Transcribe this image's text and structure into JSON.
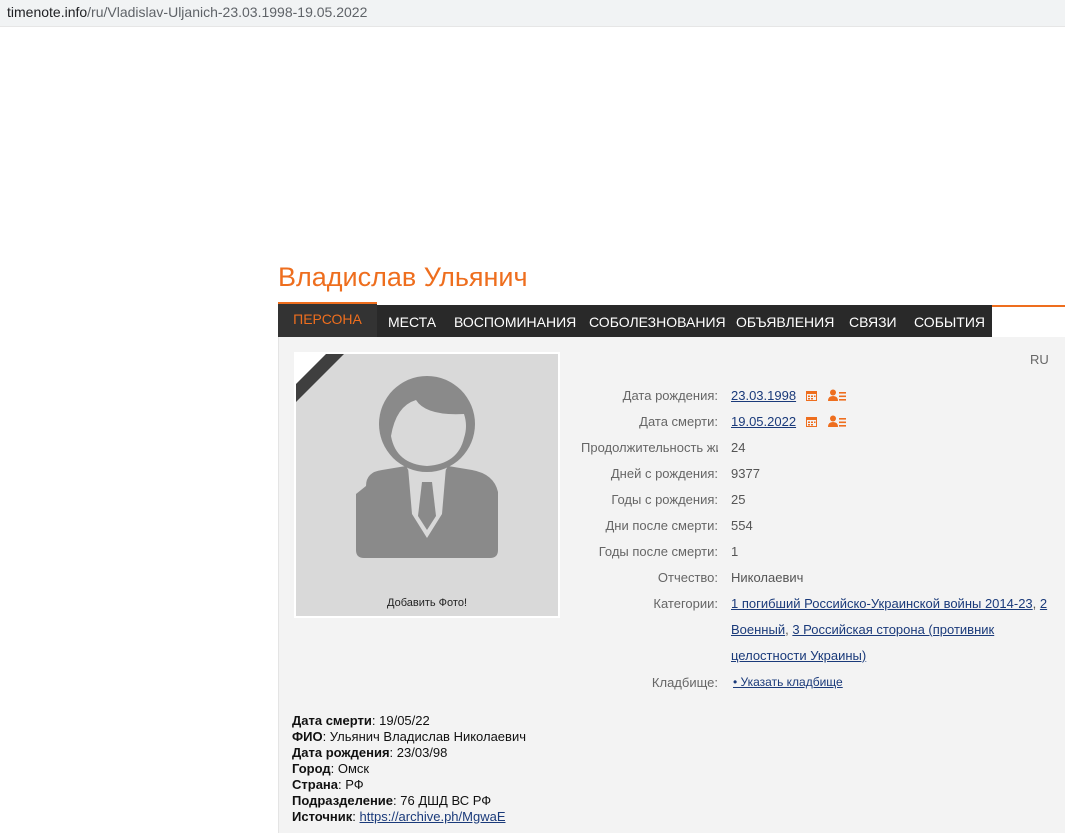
{
  "browser": {
    "url_domain": "timenote.info",
    "url_path": "/ru/Vladislav-Uljanich-23.03.1998-19.05.2022"
  },
  "page": {
    "title": "Владислав Ульянич",
    "lang": "RU"
  },
  "nav": {
    "tabs": [
      "ПЕРСОНА",
      "МЕСТА",
      "ВОСПОМИНАНИЯ",
      "СОБОЛЕЗНОВАНИЯ",
      "ОБЪЯВЛЕНИЯ",
      "СВЯЗИ",
      "СОБЫТИЯ"
    ],
    "active": "ПЕРСОНА"
  },
  "photo": {
    "add_label": "Добавить Фото!"
  },
  "facts": {
    "birth_label": "Дата рождения:",
    "birth_value": "23.03.1998",
    "death_label": "Дата смерти:",
    "death_value": "19.05.2022",
    "lifespan_label": "Продолжительность жизни:",
    "lifespan_value": "24",
    "days_since_birth_label": "Дней с рождения:",
    "days_since_birth_value": "9377",
    "years_since_birth_label": "Годы с рождения:",
    "years_since_birth_value": "25",
    "days_since_death_label": "Дни после смерти:",
    "days_since_death_value": "554",
    "years_since_death_label": "Годы после смерти:",
    "years_since_death_value": "1",
    "patronymic_label": "Отчество:",
    "patronymic_value": "Николаевич",
    "categories_label": "Категории:",
    "categories": [
      "1 погибший Российско-Украинской войны 2014-23",
      "2 Военный",
      "3 Российская сторона (противник целостности Украины)"
    ],
    "cemetery_label": "Кладбище:",
    "cemetery_link": "• Указать кладбище"
  },
  "info": {
    "death_date_key": "Дата смерти",
    "death_date_val": ": 19/05/22",
    "fio_key": "ФИО",
    "fio_val": ": Ульянич Владислав Николаевич",
    "birth_key": "Дата рождения",
    "birth_val": ": 23/03/98",
    "city_key": "Город",
    "city_val": ": Омск",
    "country_key": "Страна",
    "country_val": ": РФ",
    "unit_key": "Подразделение",
    "unit_val": ": 76 ДШД ВС РФ",
    "source_key": "Источник",
    "source_sep": ": ",
    "source_link": "https://archive.ph/MgwaE"
  },
  "colors": {
    "accent": "#ee6e1e",
    "nav_bg": "#292929",
    "link": "#1a3a7a"
  }
}
